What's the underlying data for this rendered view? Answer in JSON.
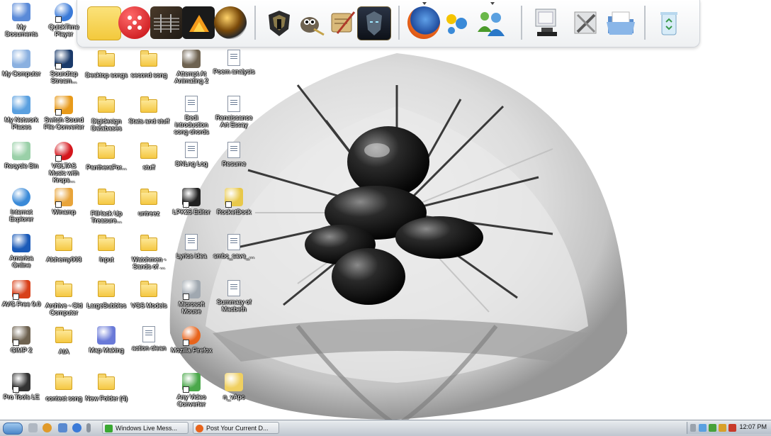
{
  "desktop": {
    "icons": [
      {
        "label": "My Documents",
        "type": "mydocs"
      },
      {
        "label": "QuickTime Player",
        "type": "quicktime",
        "shortcut": true
      },
      {
        "label": "My Computer",
        "type": "computer"
      },
      {
        "label": "Soundtap Stream...",
        "type": "soundtap",
        "shortcut": true
      },
      {
        "label": "Desktop songs",
        "type": "folder"
      },
      {
        "label": "second song",
        "type": "folder"
      },
      {
        "label": "Attempt At Animating 2",
        "type": "gimp",
        "shortcut": false
      },
      {
        "label": "Poem analysis",
        "type": "doc"
      },
      {
        "label": "My Network Places",
        "type": "network"
      },
      {
        "label": "Switch Sound File Converter",
        "type": "switch",
        "shortcut": true
      },
      {
        "label": "Digidesign Databases",
        "type": "folder"
      },
      {
        "label": "Stats and stuff",
        "type": "folder"
      },
      {
        "label": "Dedi introduction song chords",
        "type": "doc"
      },
      {
        "label": "Renaissance Art Essay",
        "type": "doc"
      },
      {
        "label": "Recycle Bin",
        "type": "recycle"
      },
      {
        "label": "VOLTAS Music with Krops...",
        "type": "dice",
        "shortcut": true
      },
      {
        "label": "PantheraFor...",
        "type": "folder"
      },
      {
        "label": "stuff",
        "type": "folder"
      },
      {
        "label": "DNLng Log",
        "type": "doc"
      },
      {
        "label": "Resume",
        "type": "doc"
      },
      {
        "label": "Internet Explorer",
        "type": "ie"
      },
      {
        "label": "Winamp",
        "type": "winamp",
        "shortcut": true
      },
      {
        "label": "FilHack Up Treasure...",
        "type": "folder"
      },
      {
        "label": "untreez",
        "type": "folder"
      },
      {
        "label": "LPK25 Editor",
        "type": "akai",
        "shortcut": true
      },
      {
        "label": "RocketDock",
        "type": "rocket",
        "shortcut": true
      },
      {
        "label": "America Online",
        "type": "aol"
      },
      {
        "label": "Alchemy003",
        "type": "folder"
      },
      {
        "label": "Input",
        "type": "folder"
      },
      {
        "label": "Watchmen - Sands of ...",
        "type": "folder"
      },
      {
        "label": "Lyrics idea",
        "type": "doc"
      },
      {
        "label": "smbc_save_...",
        "type": "doc"
      },
      {
        "label": "AVG Free 9.0",
        "type": "avg",
        "shortcut": true
      },
      {
        "label": "Archive - Old Computer",
        "type": "folder"
      },
      {
        "label": "LargeBubbles",
        "type": "folder"
      },
      {
        "label": "VGS Models",
        "type": "folder"
      },
      {
        "label": "Microsoft Mouse",
        "type": "mouse",
        "shortcut": true
      },
      {
        "label": "Summary of Macbeth",
        "type": "doc"
      },
      {
        "label": "GIMP 2",
        "type": "gimp",
        "shortcut": true
      },
      {
        "label": "AIA",
        "type": "folder"
      },
      {
        "label": "Map Making",
        "type": "gear"
      },
      {
        "label": "action clean",
        "type": "doc"
      },
      {
        "label": "Mozilla Firefox",
        "type": "firefox",
        "shortcut": true
      },
      {
        "label": "Pro Tools LE",
        "type": "protools",
        "shortcut": true
      },
      {
        "label": "contest song",
        "type": "folder"
      },
      {
        "label": "New Folder (4)",
        "type": "folder"
      },
      {
        "label": "Any Video Converter",
        "type": "video",
        "shortcut": true
      },
      {
        "label": "n_vApc",
        "type": "zip"
      }
    ]
  },
  "dock": {
    "items": [
      {
        "name": "folder-yellow",
        "color": "#f7d95a"
      },
      {
        "name": "dice-red",
        "color": "#d4161c"
      },
      {
        "name": "guitar",
        "color": "#5a4a3a"
      },
      {
        "name": "fl-studio",
        "color": "#e88b12"
      },
      {
        "name": "disc-orb",
        "color": "#444444"
      },
      {
        "name": "warcraft-helm",
        "color": "#333333"
      },
      {
        "name": "gimp",
        "color": "#7a6a50"
      },
      {
        "name": "scroll",
        "color": "#a07c48"
      },
      {
        "name": "lich-king",
        "color": "#3a4a5e"
      },
      {
        "name": "firefox",
        "color": "#e8641c"
      },
      {
        "name": "messenger",
        "color": "#3f8fd8"
      },
      {
        "name": "live-messenger",
        "color": "#47a13a"
      },
      {
        "name": "my-computer",
        "color": "#c0c8d0"
      },
      {
        "name": "tools",
        "color": "#8a8a8a"
      },
      {
        "name": "folder-blue",
        "color": "#6b9ad2"
      },
      {
        "name": "recycle-bin",
        "color": "#a9cfe9"
      }
    ]
  },
  "taskbar": {
    "tasks": [
      {
        "label": "Windows Live Mess...",
        "icon_color": "#3aa832"
      },
      {
        "label": "Post Your Current D...",
        "icon_color": "#e8641c"
      }
    ],
    "clock": "12:07 PM"
  },
  "colors": {
    "folder": "#f5c842",
    "taskbar": "#cfd6de"
  }
}
